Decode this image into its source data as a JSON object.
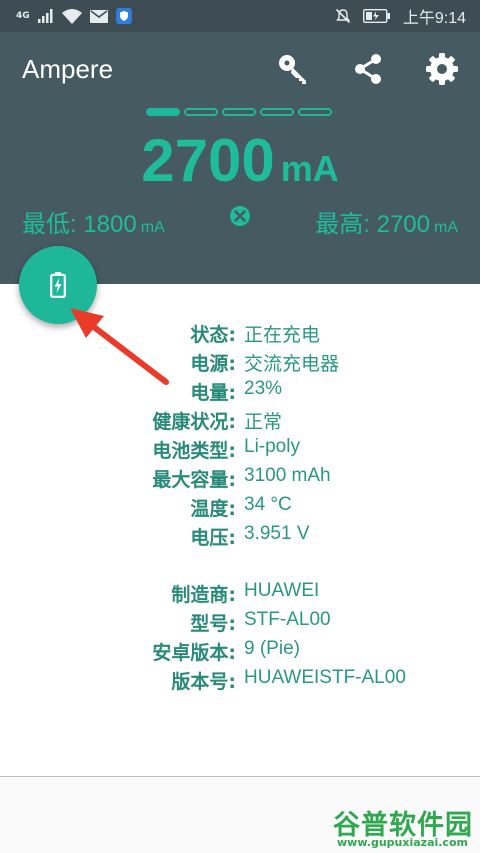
{
  "status_bar": {
    "network_type": "4G",
    "time": "上午9:14",
    "icons": [
      "signal-icon",
      "wifi-icon",
      "mail-icon",
      "shield-app-icon",
      "mute-icon",
      "battery-icon"
    ]
  },
  "app_bar": {
    "title": "Ampere",
    "actions": [
      "key-icon",
      "share-icon",
      "settings-gear-icon"
    ]
  },
  "pager": {
    "count": 5,
    "active_index": 0
  },
  "current": {
    "value": "2700",
    "unit": "mA"
  },
  "min": {
    "label": "最低: 1800",
    "unit": "mA"
  },
  "max": {
    "label": "最高: 2700",
    "unit": "mA"
  },
  "colors": {
    "header": "#455a61",
    "status_bar": "#3e4d53",
    "accent": "#1fb79a",
    "label": "#2a8a79",
    "annotation_arrow": "#ea3b2a"
  },
  "battery_info": [
    {
      "label": "状态:",
      "value": "正在充电"
    },
    {
      "label": "电源:",
      "value": "交流充电器"
    },
    {
      "label": "电量:",
      "value": "23%"
    },
    {
      "label": "健康状况:",
      "value": "正常"
    },
    {
      "label": "电池类型:",
      "value": "Li-poly"
    },
    {
      "label": "最大容量:",
      "value": "3100 mAh"
    },
    {
      "label": "温度:",
      "value": "34 °C"
    },
    {
      "label": "电压:",
      "value": "3.951 V"
    }
  ],
  "device_info": [
    {
      "label": "制造商:",
      "value": "HUAWEI"
    },
    {
      "label": "型号:",
      "value": "STF-AL00"
    },
    {
      "label": "安卓版本:",
      "value": "9 (Pie)"
    },
    {
      "label": "版本号:",
      "value": "HUAWEISTF-AL00"
    }
  ],
  "watermark": {
    "logo": "谷普软件园",
    "url": "www.gupuxiazai.com"
  }
}
